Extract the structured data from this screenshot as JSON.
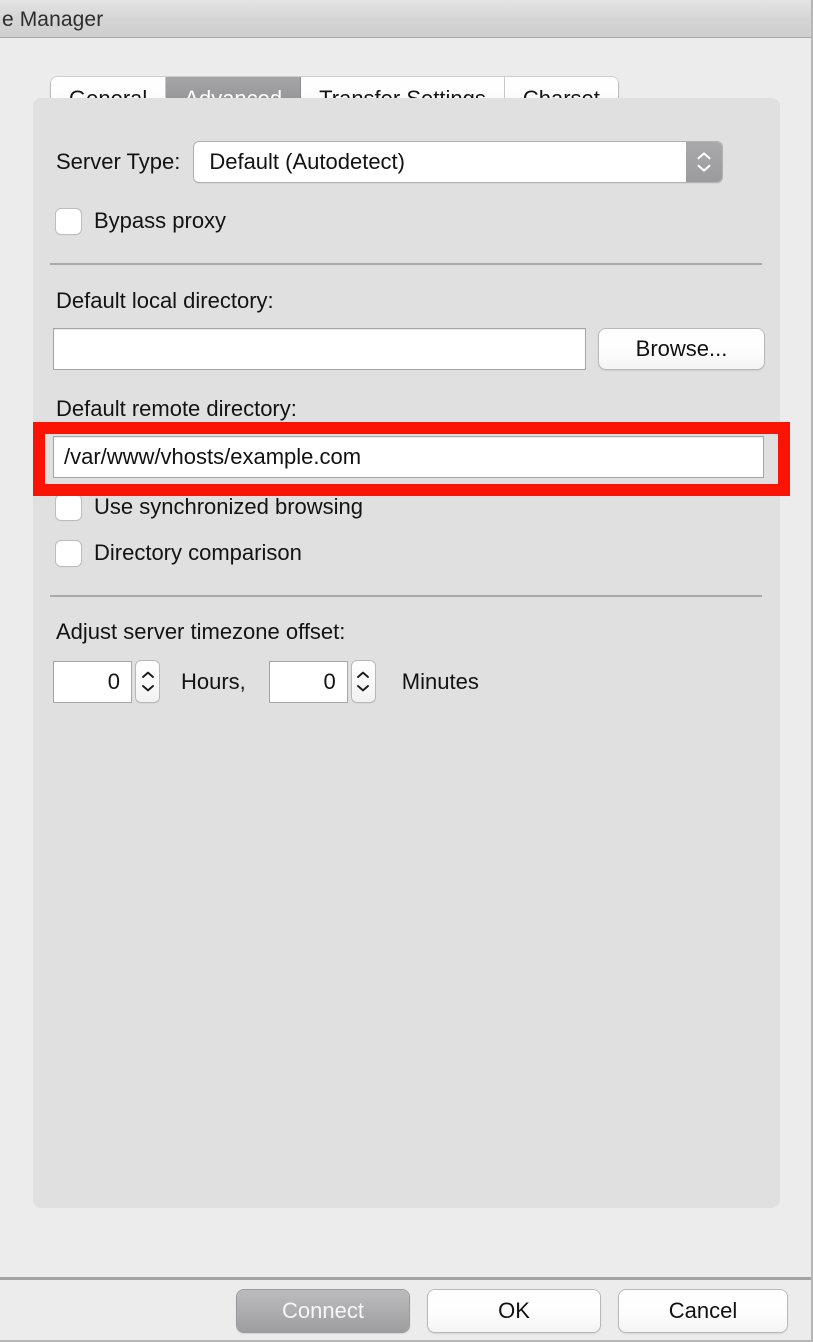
{
  "window": {
    "title": "e Manager"
  },
  "tabs": [
    {
      "label": "General",
      "selected": false
    },
    {
      "label": "Advanced",
      "selected": true
    },
    {
      "label": "Transfer Settings",
      "selected": false
    },
    {
      "label": "Charset",
      "selected": false
    }
  ],
  "advanced": {
    "server_type_label": "Server Type:",
    "server_type_value": "Default (Autodetect)",
    "bypass_proxy_label": "Bypass proxy",
    "bypass_proxy_checked": false,
    "local_dir_label": "Default local directory:",
    "local_dir_value": "",
    "local_dir_placeholder": "",
    "browse_label": "Browse...",
    "remote_dir_label": "Default remote directory:",
    "remote_dir_value": "/var/www/vhosts/example.com",
    "remote_dir_placeholder": "",
    "sync_browsing_label": "Use synchronized browsing",
    "sync_browsing_checked": false,
    "dir_comparison_label": "Directory comparison",
    "dir_comparison_checked": false,
    "timezone_label": "Adjust server timezone offset:",
    "hours_value": "0",
    "hours_label": "Hours,",
    "minutes_value": "0",
    "minutes_label": "Minutes"
  },
  "footer": {
    "connect_label": "Connect",
    "ok_label": "OK",
    "cancel_label": "Cancel"
  },
  "annotation": {
    "highlight_color": "#f91405",
    "target": "default-remote-directory-field"
  },
  "colors": {
    "window_bg": "#ececec",
    "panel_bg": "#e0e0e0",
    "titlebar_bg": "#d6d6d6",
    "selected_tab_bg": "#999999",
    "field_bg": "#ffffff",
    "text": "#111111",
    "divider": "#a8a8a8"
  }
}
